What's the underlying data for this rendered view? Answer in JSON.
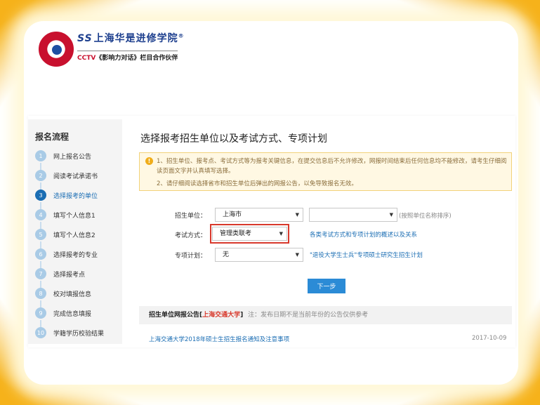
{
  "header": {
    "logo_name": "上海华是进修学院",
    "brand_ss": "SS",
    "brand_reg": "®",
    "brand_cctv": "CCTV",
    "brand_partner": "《影响力对话》栏目合作伙伴"
  },
  "sidebar": {
    "title": "报名流程",
    "steps": [
      {
        "num": "1",
        "label": "网上报名公告"
      },
      {
        "num": "2",
        "label": "阅读考试承诺书"
      },
      {
        "num": "3",
        "label": "选择报考的单位",
        "active": true
      },
      {
        "num": "4",
        "label": "填写个人信息1"
      },
      {
        "num": "5",
        "label": "填写个人信息2"
      },
      {
        "num": "6",
        "label": "选择报考的专业"
      },
      {
        "num": "7",
        "label": "选择报考点"
      },
      {
        "num": "8",
        "label": "校对填报信息"
      },
      {
        "num": "9",
        "label": "完成信息填报"
      },
      {
        "num": "10",
        "label": "学籍学历校验结果"
      }
    ]
  },
  "main": {
    "title": "选择报考招生单位以及考试方式、专项计划",
    "notice": {
      "line1": "1、招生单位、报考点、考试方式等为报考关键信息，在提交信息后不允许修改，网报时间结束后任何信息均不能修改，请考生仔细阅读页面文字并认真填写选择。",
      "line2": "2、请仔细阅读选择省市和招生单位后弹出的网报公告，以免导致报名无效。"
    },
    "form": {
      "unit_label": "招生单位：",
      "unit_province": "上海市",
      "unit_school": "",
      "unit_hint": "(按照单位名称排序)",
      "exam_label": "考试方式：",
      "exam_value": "管理类联考",
      "exam_link": "各类考试方式和专项计划的概述以及关系",
      "plan_label": "专项计划：",
      "plan_value": "无",
      "plan_link": "\"退役大学生士兵\"专项硕士研究生招生计划",
      "next_button": "下一步"
    },
    "board": {
      "title_prefix": "招生单位网报公告",
      "bracket_open": "[",
      "school": "上海交通大学",
      "bracket_close": "]",
      "note": "注：发布日期不是当前年份的公告仅供参考",
      "items": [
        {
          "title": "上海交通大学2018年硕士生招生报名通知及注意事项",
          "date": "2017-10-09"
        }
      ]
    }
  },
  "colors": {
    "frame": "#f6b21a",
    "accent": "#1a6db3",
    "highlight": "#d8392c",
    "button": "#2b8bd6"
  }
}
